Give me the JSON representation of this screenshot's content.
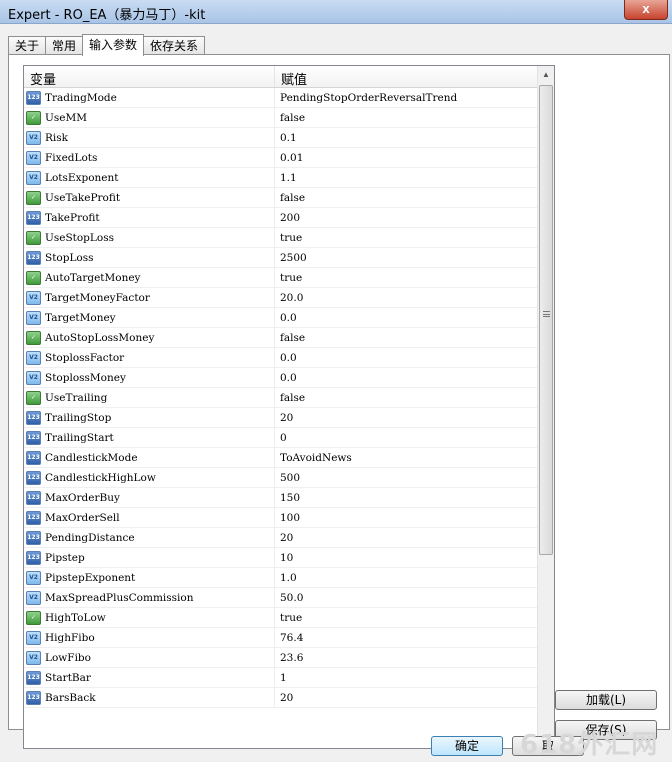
{
  "window": {
    "title": "Expert - RO_EA（暴力马丁）-kit",
    "close": "x"
  },
  "tabs": [
    {
      "label": "关于",
      "active": false
    },
    {
      "label": "常用",
      "active": false
    },
    {
      "label": "输入参数",
      "active": true
    },
    {
      "label": "依存关系",
      "active": false
    }
  ],
  "list": {
    "header_variable": "变量",
    "header_value": "赋值",
    "rows": [
      {
        "name": "TradingMode",
        "value": "PendingStopOrderReversalTrend",
        "icon": "int-icon"
      },
      {
        "name": "UseMM",
        "value": "false",
        "icon": "bool-icon"
      },
      {
        "name": "Risk",
        "value": "0.1",
        "icon": "double-icon"
      },
      {
        "name": "FixedLots",
        "value": "0.01",
        "icon": "double-icon"
      },
      {
        "name": "LotsExponent",
        "value": "1.1",
        "icon": "double-icon"
      },
      {
        "name": "UseTakeProfit",
        "value": "false",
        "icon": "bool-icon"
      },
      {
        "name": "TakeProfit",
        "value": "200",
        "icon": "int-icon"
      },
      {
        "name": "UseStopLoss",
        "value": "true",
        "icon": "bool-icon"
      },
      {
        "name": "StopLoss",
        "value": "2500",
        "icon": "int-icon"
      },
      {
        "name": "AutoTargetMoney",
        "value": "true",
        "icon": "bool-icon"
      },
      {
        "name": "TargetMoneyFactor",
        "value": "20.0",
        "icon": "double-icon"
      },
      {
        "name": "TargetMoney",
        "value": "0.0",
        "icon": "double-icon"
      },
      {
        "name": "AutoStopLossMoney",
        "value": "false",
        "icon": "bool-icon"
      },
      {
        "name": "StoplossFactor",
        "value": "0.0",
        "icon": "double-icon"
      },
      {
        "name": "StoplossMoney",
        "value": "0.0",
        "icon": "double-icon"
      },
      {
        "name": "UseTrailing",
        "value": "false",
        "icon": "bool-icon"
      },
      {
        "name": "TrailingStop",
        "value": "20",
        "icon": "int-icon"
      },
      {
        "name": "TrailingStart",
        "value": "0",
        "icon": "int-icon"
      },
      {
        "name": "CandlestickMode",
        "value": "ToAvoidNews",
        "icon": "int-icon"
      },
      {
        "name": "CandlestickHighLow",
        "value": "500",
        "icon": "int-icon"
      },
      {
        "name": "MaxOrderBuy",
        "value": "150",
        "icon": "int-icon"
      },
      {
        "name": "MaxOrderSell",
        "value": "100",
        "icon": "int-icon"
      },
      {
        "name": "PendingDistance",
        "value": "20",
        "icon": "int-icon"
      },
      {
        "name": "Pipstep",
        "value": "10",
        "icon": "int-icon"
      },
      {
        "name": "PipstepExponent",
        "value": "1.0",
        "icon": "double-icon"
      },
      {
        "name": "MaxSpreadPlusCommission",
        "value": "50.0",
        "icon": "double-icon"
      },
      {
        "name": "HighToLow",
        "value": "true",
        "icon": "bool-icon"
      },
      {
        "name": "HighFibo",
        "value": "76.4",
        "icon": "double-icon"
      },
      {
        "name": "LowFibo",
        "value": "23.6",
        "icon": "double-icon"
      },
      {
        "name": "StartBar",
        "value": "1",
        "icon": "int-icon"
      },
      {
        "name": "BarsBack",
        "value": "20",
        "icon": "int-icon"
      }
    ]
  },
  "buttons": {
    "load": "加载(L)",
    "save": "保存(S)",
    "ok": "确定",
    "cancel": "取"
  },
  "watermark": "618外汇网"
}
